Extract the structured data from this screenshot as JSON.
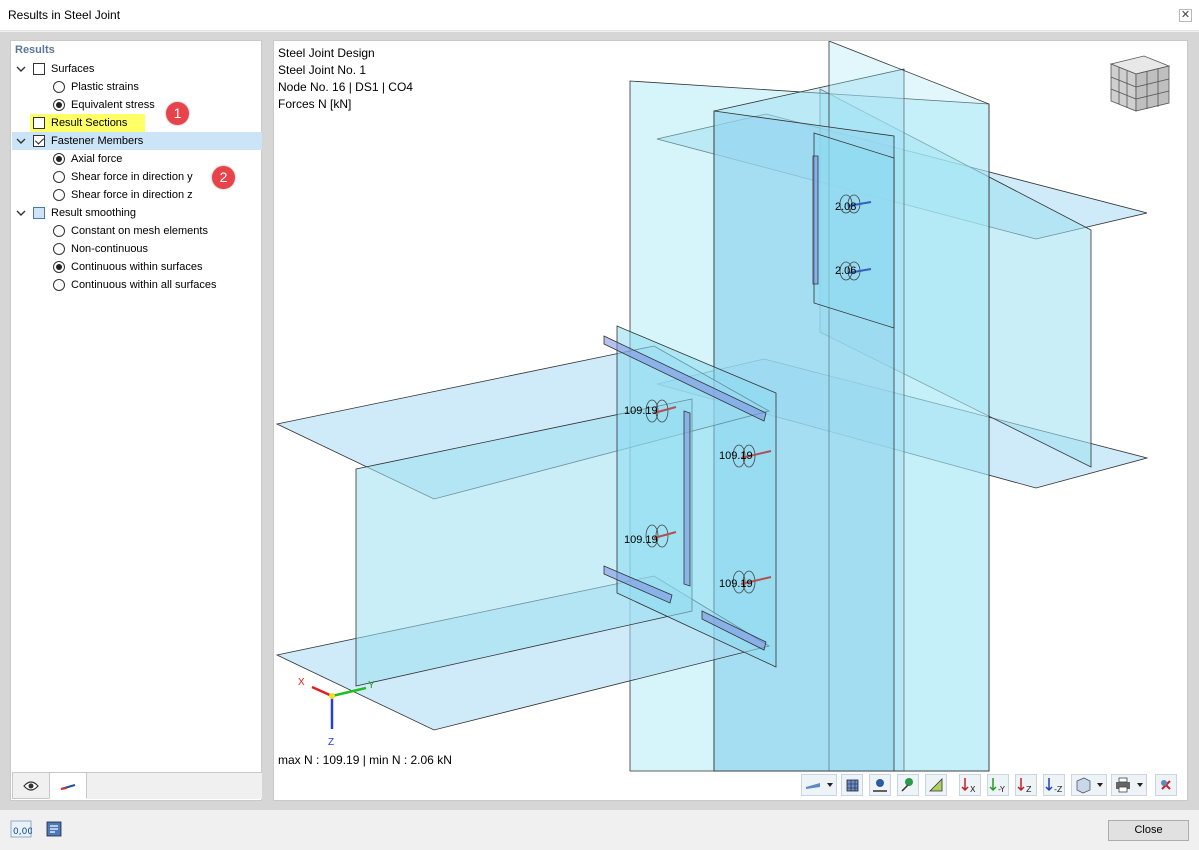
{
  "window": {
    "title": "Results in Steel Joint",
    "close_icon": "close-icon"
  },
  "tree": {
    "header": "Results",
    "surfaces": {
      "label": "Surfaces",
      "checked": false,
      "options": [
        "Plastic strains",
        "Equivalent stress"
      ],
      "selected": "Equivalent stress"
    },
    "result_sections": {
      "label": "Result Sections",
      "checked": false,
      "badge": "1"
    },
    "fastener_members": {
      "label": "Fastener Members",
      "checked": true,
      "options": [
        "Axial force",
        "Shear force in direction y",
        "Shear force in direction z"
      ],
      "selected": "Axial force",
      "badge": "2"
    },
    "result_smoothing": {
      "label": "Result smoothing",
      "checked": "partial",
      "options": [
        "Constant on mesh elements",
        "Non-continuous",
        "Continuous within surfaces",
        "Continuous within all surfaces"
      ],
      "selected": "Continuous within surfaces"
    }
  },
  "viewport": {
    "info_lines": [
      "Steel Joint Design",
      "Steel Joint No. 1",
      "Node No. 16 | DS1 | CO4",
      "Forces N [kN]"
    ],
    "values": [
      "2.08",
      "2.06",
      "109.19",
      "109.19",
      "109.19",
      "109.19"
    ],
    "summary": "max N : 109.19 | min N : 2.06 kN",
    "axes": {
      "x": "X",
      "y": "Y",
      "z": "Z"
    }
  },
  "toolbar": {
    "icons": [
      "display-mode-icon",
      "dropdown-icon",
      "mesh-icon",
      "node-icon",
      "load-icon",
      "result-icon",
      "view-x-icon",
      "view-y-icon",
      "view-z-icon",
      "view-iso-icon",
      "cube-icon",
      "dropdown-icon",
      "print-icon",
      "dropdown-icon",
      "reset-icon"
    ]
  },
  "bottom": {
    "close_label": "Close",
    "icons": [
      "decimal-icon",
      "export-icon"
    ]
  },
  "colors": {
    "accent": "#5c7596",
    "selection": "#cce4f7",
    "highlight": "#ffff66",
    "badge": "#e8434b",
    "plate": "#a8e4f2"
  }
}
